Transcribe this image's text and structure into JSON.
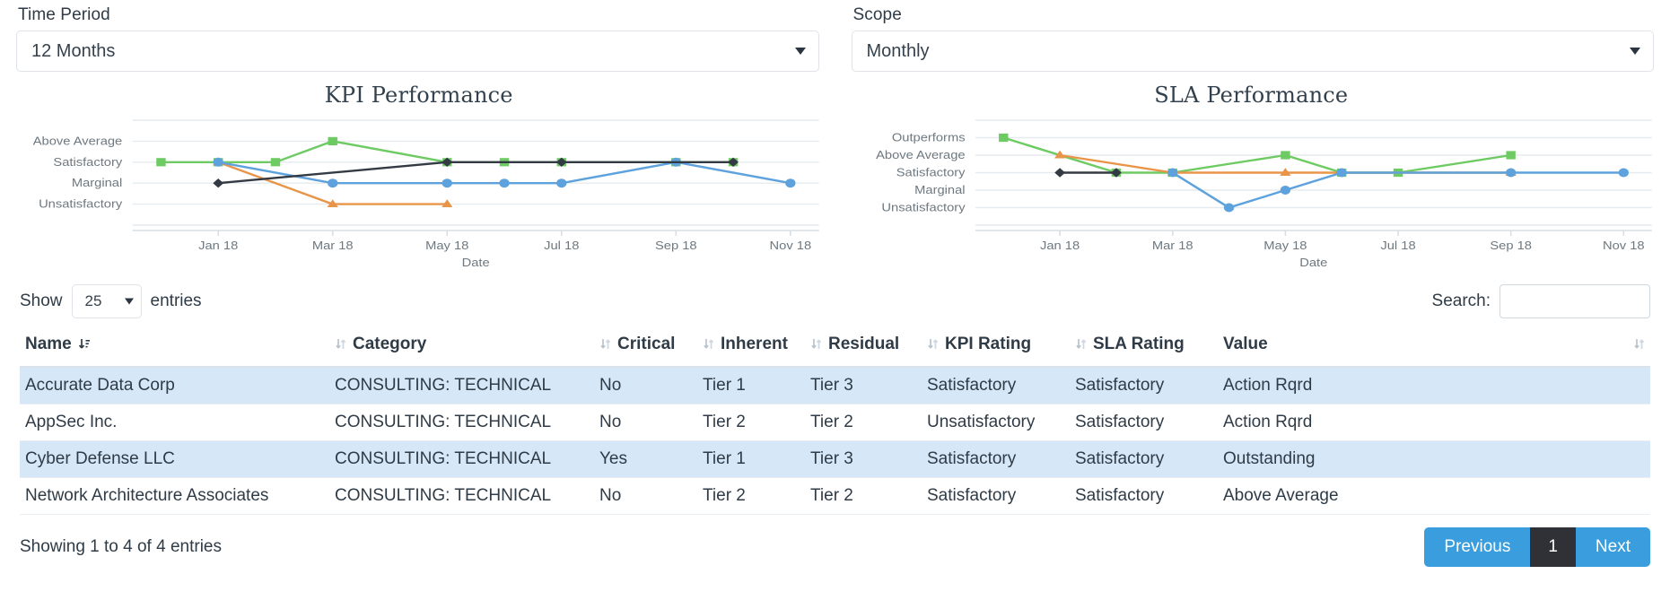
{
  "filters": {
    "time_period": {
      "label": "Time Period",
      "value": "12 Months"
    },
    "scope": {
      "label": "Scope",
      "value": "Monthly"
    }
  },
  "toolbar": {
    "show_label": "Show",
    "entries_label": "entries",
    "page_length": "25",
    "search_label": "Search:",
    "search_value": "",
    "search_placeholder": ""
  },
  "table": {
    "columns": [
      {
        "label": "Name",
        "sort": "active-desc"
      },
      {
        "label": "Category",
        "sort": "none"
      },
      {
        "label": "Critical",
        "sort": "none"
      },
      {
        "label": "Inherent",
        "sort": "none"
      },
      {
        "label": "Residual",
        "sort": "none"
      },
      {
        "label": "KPI Rating",
        "sort": "none"
      },
      {
        "label": "SLA Rating",
        "sort": "none"
      },
      {
        "label": "Value",
        "sort": "none"
      }
    ],
    "rows": [
      {
        "name": "Accurate Data Corp",
        "category": "CONSULTING: TECHNICAL",
        "critical": "No",
        "inherent": "Tier 1",
        "residual": "Tier 3",
        "kpi_rating": "Satisfactory",
        "sla_rating": "Satisfactory",
        "value": "Action Rqrd"
      },
      {
        "name": "AppSec Inc.",
        "category": "CONSULTING: TECHNICAL",
        "critical": "No",
        "inherent": "Tier 2",
        "residual": "Tier 2",
        "kpi_rating": "Unsatisfactory",
        "sla_rating": "Satisfactory",
        "value": "Action Rqrd"
      },
      {
        "name": "Cyber Defense LLC",
        "category": "CONSULTING: TECHNICAL",
        "critical": "Yes",
        "inherent": "Tier 1",
        "residual": "Tier 3",
        "kpi_rating": "Satisfactory",
        "sla_rating": "Satisfactory",
        "value": "Outstanding"
      },
      {
        "name": "Network Architecture Associates",
        "category": "CONSULTING: TECHNICAL",
        "critical": "No",
        "inherent": "Tier 2",
        "residual": "Tier 2",
        "kpi_rating": "Satisfactory",
        "sla_rating": "Satisfactory",
        "value": "Above Average"
      }
    ]
  },
  "footer": {
    "showing": "Showing 1 to 4 of 4 entries",
    "previous": "Previous",
    "page_number": "1",
    "next": "Next"
  },
  "colors": {
    "series_green": "#6ecb63",
    "series_orange": "#e8954a",
    "series_blue": "#5ea2dd",
    "series_dark": "#343a44",
    "grid": "#e6ebef",
    "row_stripe": "#d6e7f8",
    "pager_blue": "#3a9ddd",
    "pager_active": "#2f3136"
  },
  "chart_data": [
    {
      "type": "line",
      "title": "KPI Performance",
      "xlabel": "Date",
      "ylabel": "",
      "grid": true,
      "legend": "none",
      "ytick_labels": [
        "Above Average",
        "Satisfactory",
        "Marginal",
        "Unsatisfactory"
      ],
      "ylim": [
        0,
        5
      ],
      "ylevels": {
        "Above Average": 4,
        "Satisfactory": 3,
        "Marginal": 2,
        "Unsatisfactory": 1
      },
      "xtick_labels": [
        "Jan 18",
        "Mar 18",
        "May 18",
        "Jul 18",
        "Sep 18",
        "Nov 18"
      ],
      "x": [
        "Dec 17",
        "Jan 18",
        "Feb 18",
        "Mar 18",
        "Apr 18",
        "May 18",
        "Jun 18",
        "Jul 18",
        "Aug 18",
        "Sep 18",
        "Oct 18",
        "Nov 18"
      ],
      "series": [
        {
          "name": "Accurate Data Corp",
          "color": "#6ecb63",
          "marker": "square",
          "values": [
            "Satisfactory",
            "Satisfactory",
            "Satisfactory",
            "Above Average",
            null,
            "Satisfactory",
            "Satisfactory",
            "Satisfactory",
            null,
            "Satisfactory",
            "Satisfactory",
            null
          ]
        },
        {
          "name": "AppSec Inc.",
          "color": "#e8954a",
          "marker": "triangle",
          "values": [
            null,
            "Satisfactory",
            null,
            "Unsatisfactory",
            null,
            "Unsatisfactory",
            null,
            null,
            null,
            null,
            null,
            null
          ]
        },
        {
          "name": "Cyber Defense LLC",
          "color": "#5ea2dd",
          "marker": "circle",
          "values": [
            null,
            "Satisfactory",
            null,
            "Marginal",
            null,
            "Marginal",
            "Marginal",
            "Marginal",
            null,
            "Satisfactory",
            null,
            "Marginal"
          ]
        },
        {
          "name": "Network Architecture Associates",
          "color": "#343a44",
          "marker": "diamond",
          "values": [
            null,
            "Marginal",
            null,
            null,
            null,
            "Satisfactory",
            null,
            "Satisfactory",
            null,
            null,
            "Satisfactory",
            null
          ]
        }
      ]
    },
    {
      "type": "line",
      "title": "SLA Performance",
      "xlabel": "Date",
      "ylabel": "",
      "grid": true,
      "legend": "none",
      "ytick_labels": [
        "Outperforms",
        "Above Average",
        "Satisfactory",
        "Marginal",
        "Unsatisfactory"
      ],
      "ylim": [
        0,
        6
      ],
      "ylevels": {
        "Outperforms": 5,
        "Above Average": 4,
        "Satisfactory": 3,
        "Marginal": 2,
        "Unsatisfactory": 1
      },
      "xtick_labels": [
        "Jan 18",
        "Mar 18",
        "May 18",
        "Jul 18",
        "Sep 18",
        "Nov 18"
      ],
      "x": [
        "Dec 17",
        "Jan 18",
        "Feb 18",
        "Mar 18",
        "Apr 18",
        "May 18",
        "Jun 18",
        "Jul 18",
        "Aug 18",
        "Sep 18",
        "Oct 18",
        "Nov 18"
      ],
      "series": [
        {
          "name": "Accurate Data Corp",
          "color": "#6ecb63",
          "marker": "square",
          "values": [
            "Outperforms",
            null,
            "Satisfactory",
            "Satisfactory",
            null,
            "Above Average",
            "Satisfactory",
            "Satisfactory",
            null,
            "Above Average",
            null,
            null
          ]
        },
        {
          "name": "AppSec Inc.",
          "color": "#e8954a",
          "marker": "triangle",
          "values": [
            null,
            "Above Average",
            null,
            "Satisfactory",
            null,
            "Satisfactory",
            null,
            null,
            null,
            "Satisfactory",
            null,
            null
          ]
        },
        {
          "name": "Cyber Defense LLC",
          "color": "#5ea2dd",
          "marker": "circle",
          "values": [
            null,
            null,
            null,
            "Satisfactory",
            "Unsatisfactory",
            "Marginal",
            "Satisfactory",
            null,
            null,
            "Satisfactory",
            null,
            "Satisfactory"
          ]
        },
        {
          "name": "Network Architecture Associates",
          "color": "#343a44",
          "marker": "diamond",
          "values": [
            null,
            "Satisfactory",
            "Satisfactory",
            null,
            null,
            null,
            null,
            null,
            null,
            null,
            null,
            null
          ]
        }
      ]
    }
  ]
}
